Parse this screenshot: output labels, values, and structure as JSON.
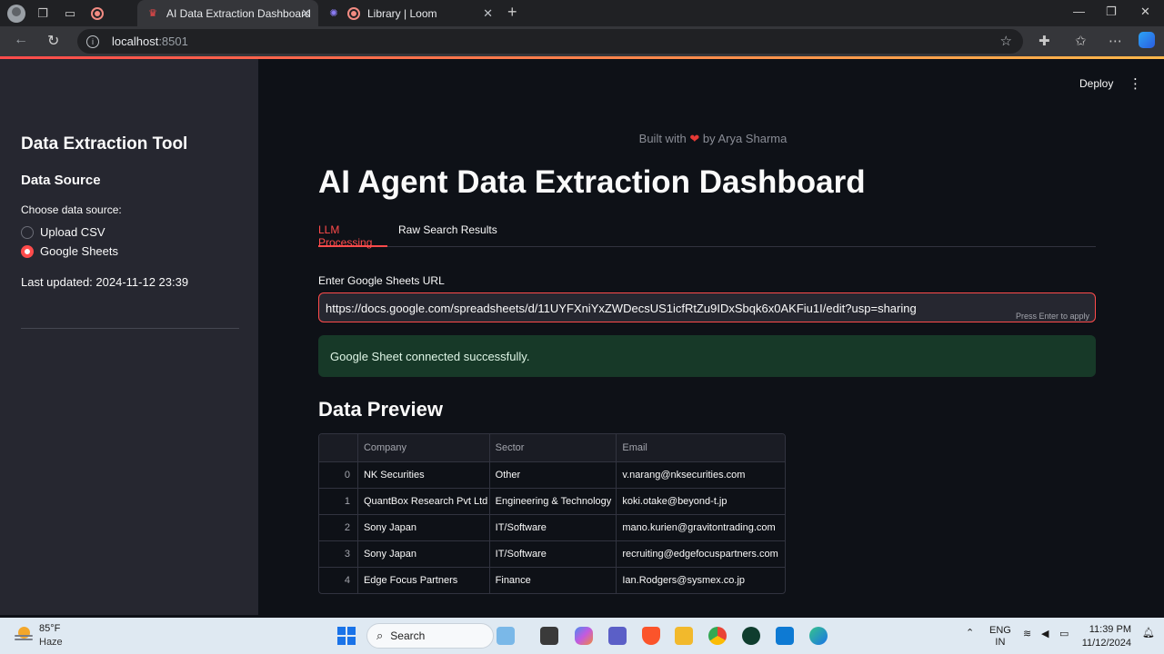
{
  "browser": {
    "tabs": [
      {
        "title": "AI Data Extraction Dashboard",
        "active": true
      },
      {
        "title": "Library | Loom",
        "active": false
      }
    ],
    "address": {
      "host": "localhost",
      "port": ":8501"
    }
  },
  "header": {
    "deploy_label": "Deploy"
  },
  "sidebar": {
    "title": "Data Extraction Tool",
    "section": "Data Source",
    "choose_label": "Choose data source:",
    "options": [
      {
        "label": "Upload CSV",
        "selected": false
      },
      {
        "label": "Google Sheets",
        "selected": true
      }
    ],
    "last_updated": "Last updated: 2024-11-12 23:39"
  },
  "main": {
    "built_prefix": "Built with",
    "built_heart": "❤",
    "built_suffix": "by Arya Sharma",
    "title": "AI Agent Data Extraction Dashboard",
    "tabs": [
      "LLM Processing",
      "Raw Search Results"
    ],
    "url_label": "Enter Google Sheets URL",
    "url_value": "https://docs.google.com/spreadsheets/d/11UYFXniYxZWDecsUS1icfRtZu9IDxSbqk6x0AKFiu1I/edit?usp=sharing",
    "url_hint": "Press Enter to apply",
    "success": "Google Sheet connected successfully.",
    "preview_title": "Data Preview",
    "table": {
      "columns": [
        "Company",
        "Sector",
        "Email"
      ],
      "rows": [
        {
          "idx": "0",
          "company": "NK Securities",
          "sector": "Other",
          "email": "v.narang@nksecurities.com"
        },
        {
          "idx": "1",
          "company": "QuantBox Research Pvt Ltd",
          "sector": "Engineering & Technology",
          "email": "koki.otake@beyond-t.jp"
        },
        {
          "idx": "2",
          "company": "Sony Japan",
          "sector": "IT/Software",
          "email": "mano.kurien@gravitontrading.com"
        },
        {
          "idx": "3",
          "company": "Sony Japan",
          "sector": "IT/Software",
          "email": "recruiting@edgefocuspartners.com"
        },
        {
          "idx": "4",
          "company": "Edge Focus Partners",
          "sector": "Finance",
          "email": "Ian.Rodgers@sysmex.co.jp"
        }
      ]
    }
  },
  "taskbar": {
    "temp": "85°F",
    "weather": "Haze",
    "search": "Search",
    "lang1": "ENG",
    "lang2": "IN",
    "time": "11:39 PM",
    "date": "11/12/2024"
  },
  "colors": {
    "accent": "#ff4b4b",
    "success_bg": "#173928",
    "sidebar_bg": "#262730",
    "main_bg": "#0e1117"
  }
}
